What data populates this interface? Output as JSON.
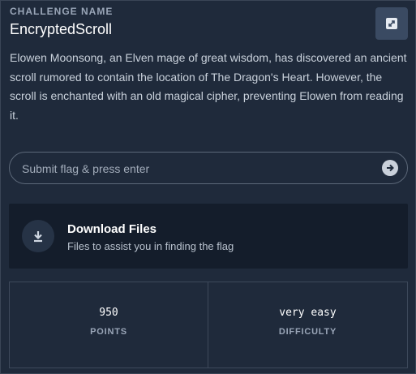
{
  "challenge": {
    "eyebrow": "CHALLENGE NAME",
    "name": "EncryptedScroll",
    "description": "Elowen Moonsong, an Elven mage of great wisdom, has discovered an ancient scroll rumored to contain the location of The Dragon's Heart. However, the scroll is enchanted with an old magical cipher, preventing Elowen from reading it."
  },
  "flag_input": {
    "placeholder": "Submit flag & press enter",
    "submit_icon": "arrow-right-circle-icon"
  },
  "download": {
    "title": "Download Files",
    "subtitle": "Files to assist you in finding the flag",
    "icon": "download-icon"
  },
  "stats": {
    "points_value": "950",
    "points_label": "POINTS",
    "difficulty_value": "very easy",
    "difficulty_label": "DIFFICULTY"
  },
  "colors": {
    "card_bg": "#1f2a3b",
    "download_bg": "#141d2b",
    "accent_btn": "#3a4a62"
  }
}
